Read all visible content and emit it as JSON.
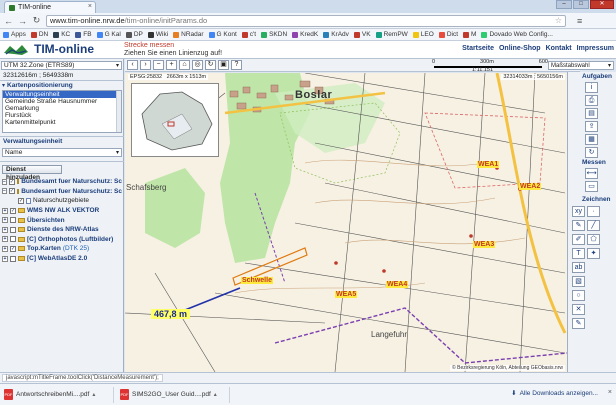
{
  "browser": {
    "tab_title": "TIM-online",
    "url_host": "www.tim-online.nrw.de",
    "url_path": "/tim-online/initParams.do",
    "bookmarks": [
      {
        "label": "Apps",
        "color": "#4285f4"
      },
      {
        "label": "DN",
        "color": "#c0392b"
      },
      {
        "label": "KC",
        "color": "#2c3e50"
      },
      {
        "label": "FB",
        "color": "#3b5998"
      },
      {
        "label": "G Kal",
        "color": "#4285f4"
      },
      {
        "label": "DP",
        "color": "#555555"
      },
      {
        "label": "Wiki",
        "color": "#333333"
      },
      {
        "label": "NRadar",
        "color": "#e67e22"
      },
      {
        "label": "G Kont",
        "color": "#4285f4"
      },
      {
        "label": "c't",
        "color": "#c0392b"
      },
      {
        "label": "SKDN",
        "color": "#27ae60"
      },
      {
        "label": "KredK",
        "color": "#8e44ad"
      },
      {
        "label": "KrAdv",
        "color": "#2980b9"
      },
      {
        "label": "VK",
        "color": "#c0392b"
      },
      {
        "label": "RemPW",
        "color": "#16a085"
      },
      {
        "label": "LEO",
        "color": "#f1c40f"
      },
      {
        "label": "Dict",
        "color": "#e74c3c"
      },
      {
        "label": "M",
        "color": "#c0392b"
      },
      {
        "label": "Dovado Web Config...",
        "color": "#2ecc71"
      }
    ]
  },
  "app": {
    "logo": "TIM-online",
    "message_title": "Strecke messen",
    "message_text": "Ziehen Sie einen Linienzug auf!",
    "top_links": [
      "Startseite",
      "Online-Shop",
      "Kontakt",
      "Impressum"
    ]
  },
  "left": {
    "crs": "UTM 32.Zone (ETRS89)",
    "coords": "32312616m ; 5649338m",
    "section_title": "Kartenpositionierung",
    "position_options": [
      "Verwaltungseinheit",
      "Gemeinde Straße Hausnummer",
      "Gemarkung",
      "Flurstück",
      "Kartenmittelpunkt"
    ],
    "admin_label": "Verwaltungseinheit",
    "admin_select": "Name",
    "add_service_button": "Dienst hinzuladen",
    "tree": [
      {
        "label": "Bundesamt fuer Naturschutz: Sc",
        "bold": true,
        "expander": "−",
        "checked": true
      },
      {
        "label": "Bundesamt fuer Naturschutz: Sc",
        "bold": true,
        "expander": "−",
        "checked": true
      },
      {
        "label": "Naturschutzgebiete",
        "bold": false,
        "expander": "",
        "checked": true,
        "indent": true
      },
      {
        "label": "WMS NW ALK VEKTOR",
        "bold": true,
        "expander": "+",
        "checked": true
      },
      {
        "label": "Übersichten",
        "bold": true,
        "expander": "+",
        "checked": false
      },
      {
        "label": "Dienste des NRW-Atlas",
        "bold": true,
        "expander": "+",
        "checked": false
      },
      {
        "label": "[C] Orthophotos (Luftbilder)",
        "bold": true,
        "expander": "+",
        "checked": false
      },
      {
        "label": "Top.Karten",
        "bold": true,
        "expander": "+",
        "checked": true,
        "suffix": "(DTK 25)"
      },
      {
        "label": "[C] WebAtlasDE 2.0",
        "bold": true,
        "expander": "+",
        "checked": false
      }
    ]
  },
  "map": {
    "epsg": "EPSG:25832",
    "extent": "2663m x 1513m",
    "coord_right": "32314033m ; 5650156m",
    "scale_labels": [
      "0",
      "300m",
      "600"
    ],
    "scale_ratio": "1:11.151",
    "scale_select": "Maßstabswahl",
    "town": "Boslar",
    "street_1": "Schafsberg",
    "street_2": "Langefuhr",
    "labels": [
      {
        "text": "WEA1",
        "style": "y"
      },
      {
        "text": "WEA2",
        "style": "y"
      },
      {
        "text": "WEA3",
        "style": "y"
      },
      {
        "text": "WEA4",
        "style": "y"
      },
      {
        "text": "WEA5",
        "style": "y"
      },
      {
        "text": "Schwelle",
        "style": "y"
      }
    ],
    "measure": "467,8 m",
    "credit": "© Bezirksregierung Köln, Abteilung GEObasis.nrw"
  },
  "tools": {
    "group1": "Aufgaben",
    "group2": "Messen",
    "group3": "Zeichnen"
  },
  "status": {
    "text": "javascript:mTitleFrame.toolClick('DistanceMeasurement');"
  },
  "downloads": {
    "items": [
      "AntwortschreibenMi....pdf",
      "SIMS2GO_User Guid....pdf"
    ],
    "show_all": "Alle Downloads anzeigen..."
  }
}
